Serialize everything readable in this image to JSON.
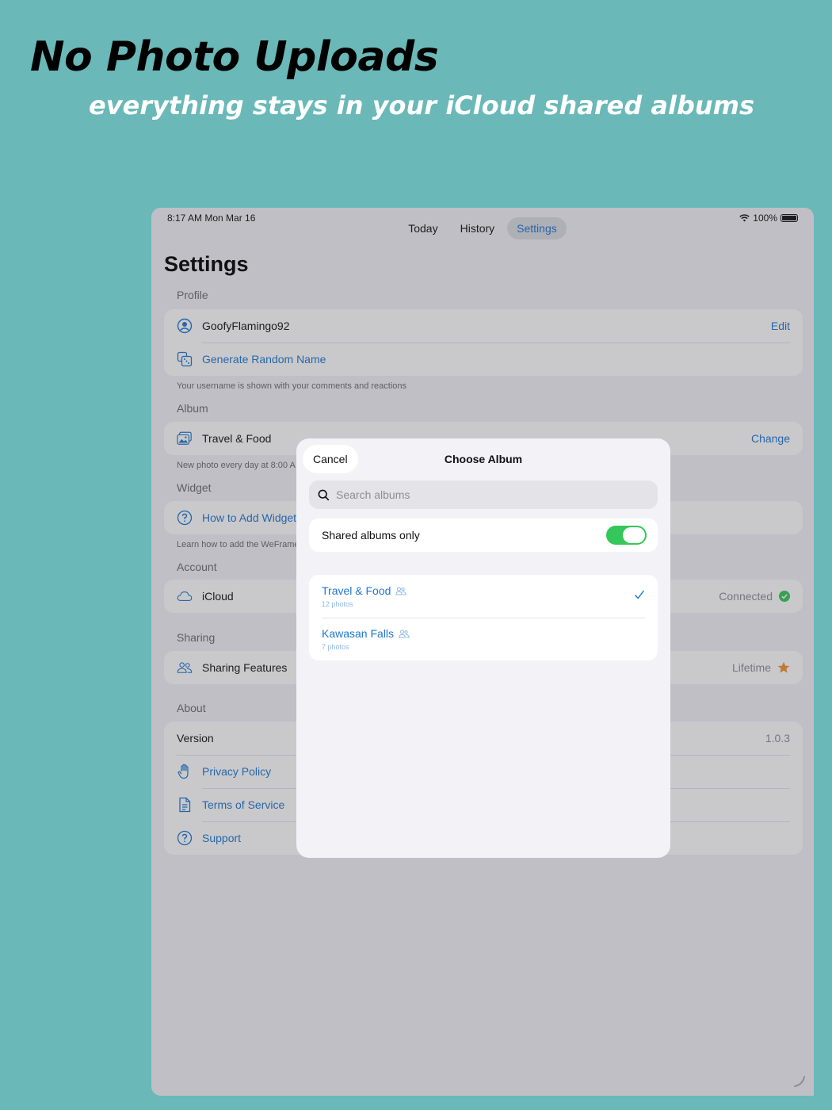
{
  "headline": "No Photo Uploads",
  "subline": "everything stays in your iCloud shared albums",
  "status": {
    "time": "8:17 AM   Mon Mar 16",
    "battery": "100%"
  },
  "tabs": [
    {
      "label": "Today",
      "active": false
    },
    {
      "label": "History",
      "active": false
    },
    {
      "label": "Settings",
      "active": true
    }
  ],
  "page_title": "Settings",
  "profile": {
    "section": "Profile",
    "username": "GoofyFlamingo92",
    "edit_label": "Edit",
    "generate_label": "Generate Random Name",
    "footnote": "Your username is shown with your comments and reactions"
  },
  "album": {
    "section": "Album",
    "name": "Travel & Food",
    "change_label": "Change",
    "footnote": "New photo every day at 8:00 A"
  },
  "widget": {
    "section": "Widget",
    "how_label": "How to Add Widget",
    "footnote": "Learn how to add the WeFrame"
  },
  "account": {
    "section": "Account",
    "label": "iCloud",
    "status": "Connected"
  },
  "sharing": {
    "section": "Sharing",
    "label": "Sharing Features",
    "status": "Lifetime"
  },
  "about": {
    "section": "About",
    "version_label": "Version",
    "version_value": "1.0.3",
    "privacy_label": "Privacy Policy",
    "terms_label": "Terms of Service",
    "support_label": "Support"
  },
  "modal": {
    "cancel_label": "Cancel",
    "title": "Choose Album",
    "search_placeholder": "Search albums",
    "toggle_label": "Shared albums only",
    "toggle_on": true,
    "albums": [
      {
        "name": "Travel & Food",
        "count": "12 photos",
        "selected": true
      },
      {
        "name": "Kawasan Falls",
        "count": "7 photos",
        "selected": false
      }
    ]
  },
  "colors": {
    "background": "#6ab8b8",
    "accent": "#1f77d0",
    "toggle_on": "#34c759",
    "star": "#f2932f",
    "connected": "#34c759"
  }
}
